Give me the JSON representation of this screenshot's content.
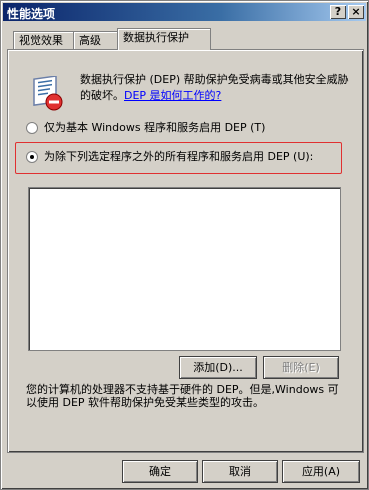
{
  "window": {
    "title": "性能选项",
    "help_glyph": "?",
    "close_glyph": "×"
  },
  "tabs": [
    {
      "label": "视觉效果"
    },
    {
      "label": "高级"
    },
    {
      "label": "数据执行保护"
    }
  ],
  "dep": {
    "description": "数据执行保护 (DEP) 帮助保护免受病毒或其他安全威胁的破坏。",
    "help_link": "DEP 是如何工作的?",
    "option1": "仅为基本 Windows 程序和服务启用 DEP (T)",
    "option2": "为除下列选定程序之外的所有程序和服务启用 DEP (U):",
    "selected_option": 2,
    "add_button": "添加(D)...",
    "remove_button": "删除(E)",
    "note": "您的计算机的处理器不支持基于硬件的 DEP。但是,Windows 可以使用 DEP 软件帮助保护免受某些类型的攻击。"
  },
  "footer": {
    "ok": "确定",
    "cancel": "取消",
    "apply": "应用(A)"
  },
  "icon_name": "shield-document-icon"
}
